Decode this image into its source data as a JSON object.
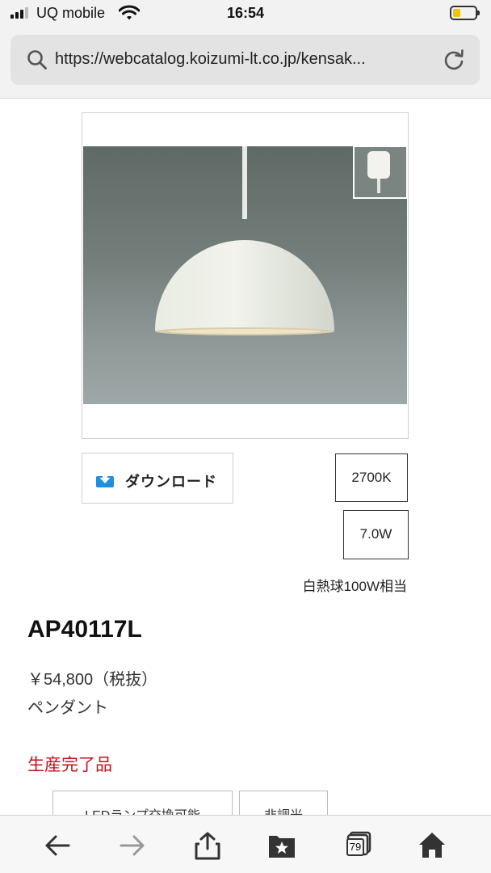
{
  "status_bar": {
    "carrier": "UQ mobile",
    "time": "16:54"
  },
  "browser": {
    "url": "https://webcatalog.koizumi-lt.co.jp/kensak...",
    "tab_count": "79"
  },
  "product": {
    "download_label": "ダウンロード",
    "color_temp": "2700K",
    "wattage": "7.0W",
    "equivalent": "白熱球100W相当",
    "model": "AP40117L",
    "price": "￥54,800（税抜）",
    "category": "ペンダント",
    "status": "生産完了品",
    "tags": [
      "LEDランプ交換可能",
      "非調光"
    ]
  },
  "colors": {
    "status_red": "#c0131b",
    "download_icon_blue": "#1f8fe0"
  },
  "icons": {
    "toolbar": [
      "back-arrow-icon",
      "forward-arrow-icon",
      "share-icon",
      "bookmarks-icon",
      "tabs-icon",
      "home-icon"
    ]
  }
}
